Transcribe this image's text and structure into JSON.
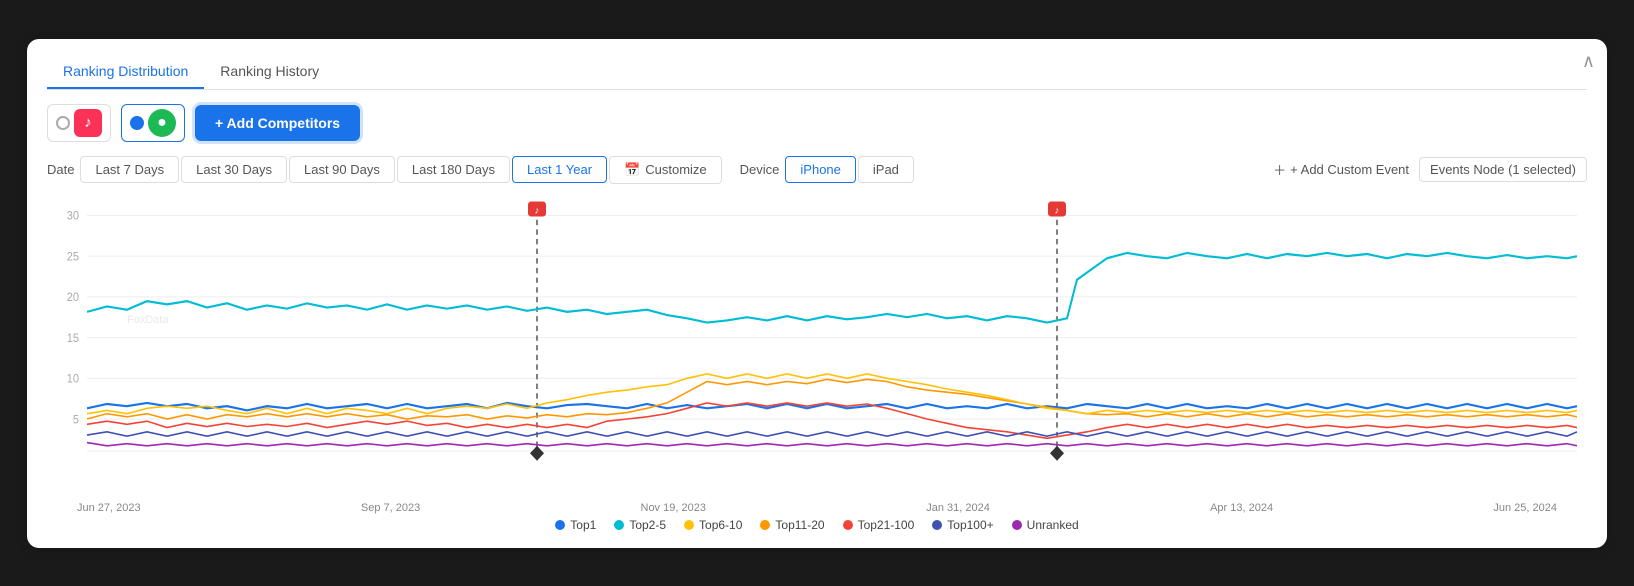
{
  "card": {
    "collapse_icon": "∧"
  },
  "tabs": [
    {
      "label": "Ranking Distribution",
      "active": true
    },
    {
      "label": "Ranking History",
      "active": false
    }
  ],
  "apps": [
    {
      "name": "Apple Music",
      "icon": "♪",
      "bg": "#fc3158",
      "selected": false
    },
    {
      "name": "Spotify",
      "icon": "●",
      "bg": "#1db954",
      "selected": true
    }
  ],
  "add_competitors_btn": "+ Add Competitors",
  "date_filters": {
    "label": "Date",
    "options": [
      {
        "label": "Last 7 Days",
        "active": false
      },
      {
        "label": "Last 30 Days",
        "active": false
      },
      {
        "label": "Last 90 Days",
        "active": false
      },
      {
        "label": "Last 180 Days",
        "active": false
      },
      {
        "label": "Last 1 Year",
        "active": true
      }
    ],
    "customize": "Customize"
  },
  "device_filters": {
    "label": "Device",
    "options": [
      {
        "label": "iPhone",
        "active": true
      },
      {
        "label": "iPad",
        "active": false
      }
    ]
  },
  "actions": {
    "add_custom_event": "+ Add Custom Event",
    "events_node": "Events Node (1 selected)"
  },
  "chart": {
    "y_labels": [
      "30",
      "25",
      "20",
      "15",
      "10",
      "5"
    ],
    "x_labels": [
      "Jun 27, 2023",
      "Sep 7, 2023",
      "Nov 19, 2023",
      "Jan 31, 2024",
      "Apr 13, 2024",
      "Jun 25, 2024"
    ],
    "event_pins": [
      {
        "x_pct": 32,
        "label": "♪"
      },
      {
        "x_pct": 66,
        "label": "♪"
      }
    ]
  },
  "legend": [
    {
      "label": "Top1",
      "color": "#1a73e8"
    },
    {
      "label": "Top2-5",
      "color": "#00bcd4"
    },
    {
      "label": "Top6-10",
      "color": "#ffc107"
    },
    {
      "label": "Top11-20",
      "color": "#ff9800"
    },
    {
      "label": "Top21-100",
      "color": "#f44336"
    },
    {
      "label": "Top100+",
      "color": "#3f51b5"
    },
    {
      "label": "Unranked",
      "color": "#9c27b0"
    }
  ],
  "watermark": "FoxData"
}
